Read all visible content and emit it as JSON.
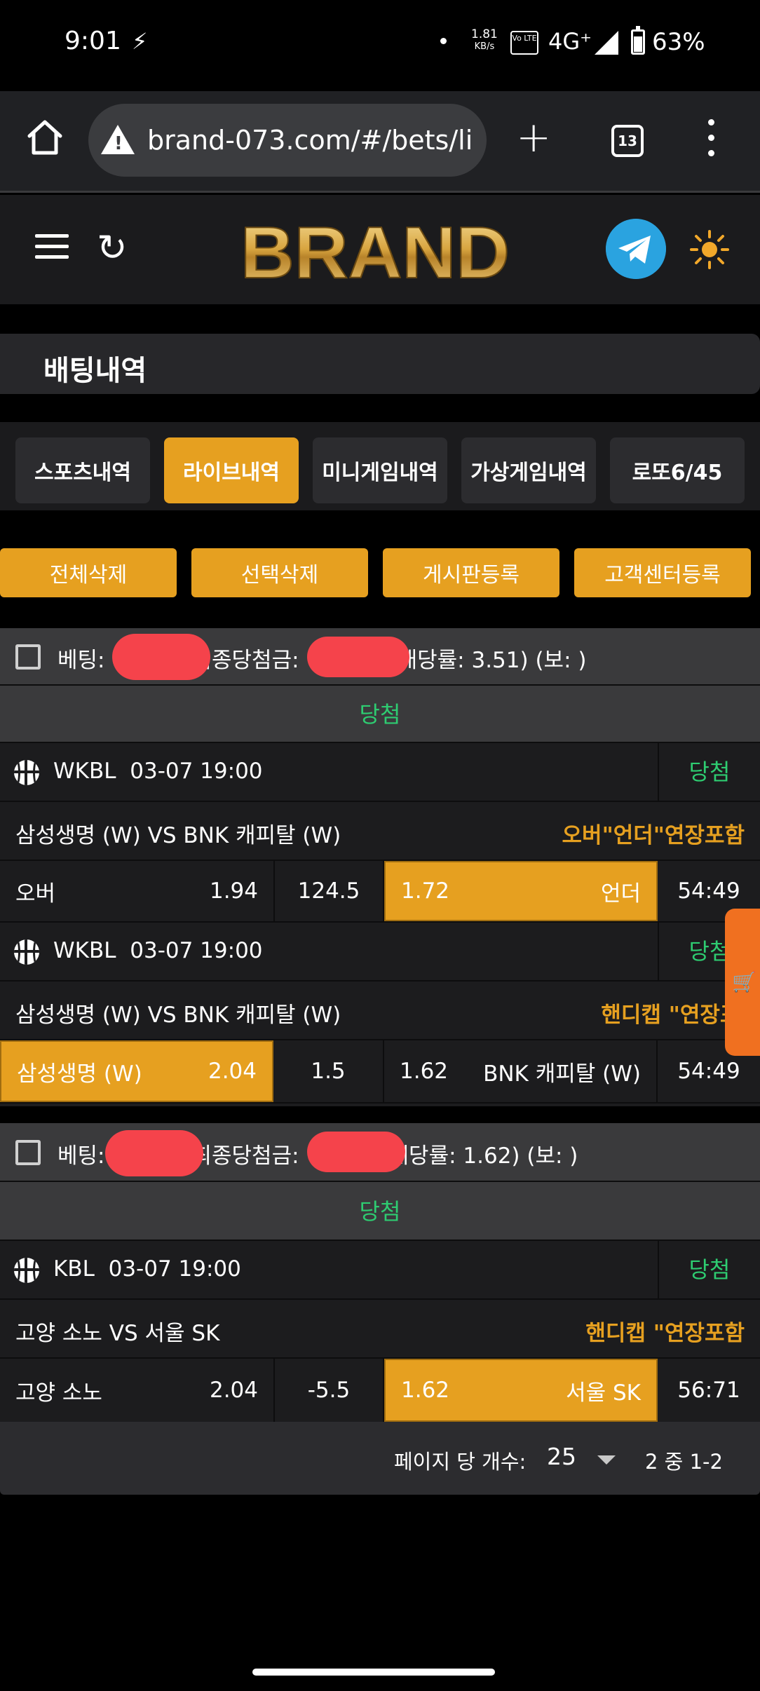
{
  "status_bar": {
    "time": "9:01",
    "speed_value": "1.81",
    "speed_unit": "KB/s",
    "volte": "Vo LTE",
    "network": "4G⁺",
    "battery": "63%"
  },
  "browser": {
    "url": "brand-073.com/#/bets/li",
    "tab_count": "13"
  },
  "header": {
    "logo_text": "BRAND"
  },
  "page": {
    "title": "배팅내역"
  },
  "tabs": [
    {
      "label": "스포츠내역",
      "active": false
    },
    {
      "label": "라이브내역",
      "active": true
    },
    {
      "label": "미니게임내역",
      "active": false
    },
    {
      "label": "가상게임내역",
      "active": false
    },
    {
      "label": "로또6/45",
      "active": false
    }
  ],
  "actions": {
    "delete_all": "전체삭제",
    "delete_selected": "선택삭제",
    "board_register": "게시판등록",
    "support_register": "고객센터등록"
  },
  "bets": [
    {
      "head_bet_label": "베팅:",
      "head_final_label": "최종당첨금:",
      "head_odds": "(배당률: 3.51) (보: )",
      "status": "당첨",
      "games": [
        {
          "league": "WKBL",
          "datetime": "03-07 19:00",
          "result": "당첨",
          "teams": "삼성생명 (W) VS BNK 캐피탈 (W)",
          "market": "오버\"언더\"연장포함",
          "home_label": "오버",
          "home_odds": "1.94",
          "line": "124.5",
          "away_odds": "1.72",
          "away_label": "언더",
          "score": "54:49",
          "selected": "away"
        },
        {
          "league": "WKBL",
          "datetime": "03-07 19:00",
          "result": "당첨",
          "teams": "삼성생명 (W) VS BNK 캐피탈 (W)",
          "market": "핸디캡 \"연장포함",
          "home_label": "삼성생명 (W)",
          "home_odds": "2.04",
          "line": "1.5",
          "away_odds": "1.62",
          "away_label": "BNK 캐피탈 (W)",
          "score": "54:49",
          "selected": "home"
        }
      ]
    },
    {
      "head_bet_label": "베팅:",
      "head_final_label": "최종당첨금:",
      "head_odds": "배당률: 1.62) (보: )",
      "status": "당첨",
      "games": [
        {
          "league": "KBL",
          "datetime": "03-07 19:00",
          "result": "당첨",
          "teams": "고양 소노 VS 서울 SK",
          "market": "핸디캡 \"연장포함",
          "home_label": "고양 소노",
          "home_odds": "2.04",
          "line": "-5.5",
          "away_odds": "1.62",
          "away_label": "서울 SK",
          "score": "56:71",
          "selected": "away"
        }
      ]
    }
  ],
  "pagination": {
    "per_page_label": "페이지 당 개수:",
    "per_page_value": "25",
    "range": "2 중 1-2"
  },
  "colors": {
    "accent": "#e6a020",
    "win": "#2ecc71",
    "cart": "#f07020",
    "telegram": "#2aa3e0",
    "redaction": "#f5434b"
  }
}
